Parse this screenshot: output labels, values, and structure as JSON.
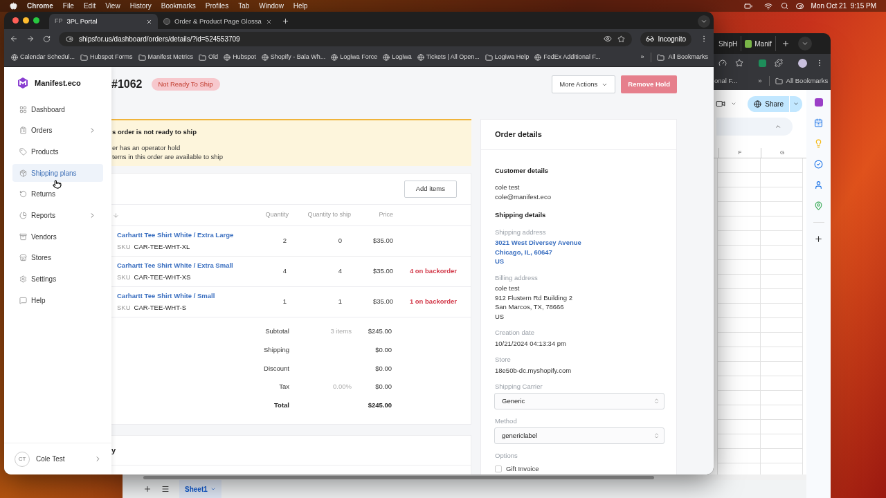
{
  "menu_bar": {
    "app": "Chrome",
    "menus": [
      "File",
      "Edit",
      "View",
      "History",
      "Bookmarks",
      "Profiles",
      "Tab",
      "Window",
      "Help"
    ],
    "clock": "Mon Oct 21  9:15 PM"
  },
  "back_window": {
    "tabs": [
      "ShipH",
      "Manif"
    ],
    "bookmarks": [
      "onal F...",
      "All Bookmarks"
    ],
    "overflow": "»",
    "share": "Share",
    "columns": [
      "F",
      "G"
    ],
    "sheet_tab": "Sheet1"
  },
  "browser": {
    "tabs": [
      {
        "favicon": "FP",
        "label": "3PL Portal",
        "selected": true
      },
      {
        "label": "Order & Product Page Glossa",
        "selected": false
      }
    ],
    "url": "shipsfor.us/dashboard/orders/details/?id=524553709",
    "profile": "Incognito",
    "bookmarks": [
      {
        "kind": "site",
        "label": "Calendar Schedul..."
      },
      {
        "kind": "folder",
        "label": "Hubspot Forms"
      },
      {
        "kind": "folder",
        "label": "Manifest Metrics"
      },
      {
        "kind": "folder",
        "label": "Old"
      },
      {
        "kind": "site",
        "label": "Hubspot"
      },
      {
        "kind": "site",
        "label": "Shopify - Bala Wh..."
      },
      {
        "kind": "site",
        "label": "Logiwa Force"
      },
      {
        "kind": "site",
        "label": "Logiwa"
      },
      {
        "kind": "site",
        "label": "Tickets | All Open..."
      },
      {
        "kind": "folder",
        "label": "Logiwa Help"
      },
      {
        "kind": "site",
        "label": "FedEx Additional F..."
      }
    ],
    "overflow": "»",
    "all_bookmarks": "All Bookmarks"
  },
  "sidebar": {
    "brand": "Manifest.eco",
    "items": [
      {
        "label": "Dashboard",
        "has_submenu": false,
        "selected": false
      },
      {
        "label": "Orders",
        "has_submenu": true,
        "selected": false
      },
      {
        "label": "Products",
        "has_submenu": false,
        "selected": false
      },
      {
        "label": "Shipping plans",
        "has_submenu": false,
        "selected": true
      },
      {
        "label": "Returns",
        "has_submenu": false,
        "selected": false
      },
      {
        "label": "Reports",
        "has_submenu": true,
        "selected": false
      },
      {
        "label": "Vendors",
        "has_submenu": false,
        "selected": false
      },
      {
        "label": "Stores",
        "has_submenu": false,
        "selected": false
      },
      {
        "label": "Settings",
        "has_submenu": false,
        "selected": false
      },
      {
        "label": "Help",
        "has_submenu": false,
        "selected": false
      }
    ],
    "user": {
      "initials": "CT",
      "name": "Cole Test"
    }
  },
  "order": {
    "number": "#1062",
    "status": "Not Ready To Ship",
    "actions": [
      {
        "label": "More Actions",
        "kind": "dropdown",
        "disabled": false
      },
      {
        "label": "Remove Hold",
        "kind": "primary",
        "disabled": true
      }
    ]
  },
  "alert": {
    "title": "s order is not ready to ship",
    "lines": [
      "er has an operator hold",
      "tems in this order are available to ship"
    ]
  },
  "items": {
    "add_button": "Add items",
    "columns": [
      "Quantity",
      "Quantity to ship",
      "Price"
    ],
    "rows": [
      {
        "name": "Carhartt Tee Shirt White / Extra Large",
        "sku_label": "SKU",
        "sku": "CAR-TEE-WHT-XL",
        "quantity": "2",
        "to_ship": "0",
        "price": "$35.00"
      },
      {
        "name": "Carhartt Tee Shirt White / Extra Small",
        "sku_label": "SKU",
        "sku": "CAR-TEE-WHT-XS",
        "quantity": "4",
        "to_ship": "4",
        "price": "$35.00",
        "backorder": "4 on backorder"
      },
      {
        "name": "Carhartt Tee Shirt White / Small",
        "sku_label": "SKU",
        "sku": "CAR-TEE-WHT-S",
        "quantity": "1",
        "to_ship": "1",
        "price": "$35.00",
        "backorder": "1 on backorder"
      }
    ],
    "totals": [
      {
        "kind": "line",
        "label": "Subtotal",
        "note": "3 items",
        "amount": "$245.00"
      },
      {
        "kind": "line",
        "label": "Shipping",
        "amount": "$0.00"
      },
      {
        "kind": "line",
        "label": "Discount",
        "amount": "$0.00"
      },
      {
        "kind": "line",
        "label": "Tax",
        "note": "0.00%",
        "amount": "$0.00"
      },
      {
        "kind": "total",
        "label": "Total",
        "amount": "$245.00"
      }
    ]
  },
  "next_card": {
    "title": "y"
  },
  "order_details": {
    "title": "Order details",
    "blocks": [
      {
        "kind": "heading",
        "text": "Customer details"
      },
      {
        "kind": "lines",
        "lines": [
          "cole test",
          "cole@manifest.eco"
        ]
      },
      {
        "kind": "heading",
        "text": "Shipping details"
      },
      {
        "kind": "field",
        "label": "Shipping address",
        "link": true,
        "lines": [
          "3021 West Diversey Avenue",
          "Chicago, IL, 60647",
          "US"
        ]
      },
      {
        "kind": "field",
        "label": "Billing address",
        "link": false,
        "lines": [
          "cole test",
          "912 Flustern Rd Building 2",
          "San Marcos, TX, 78666",
          "US"
        ]
      },
      {
        "kind": "field",
        "label": "Creation date",
        "link": false,
        "lines": [
          "10/21/2024 04:13:34 pm"
        ]
      },
      {
        "kind": "field",
        "label": "Store",
        "link": false,
        "lines": [
          "18e50b-dc.myshopify.com"
        ]
      },
      {
        "kind": "select",
        "label": "Shipping Carrier",
        "value": "Generic"
      },
      {
        "kind": "select",
        "label": "Method",
        "value": "genericlabel"
      },
      {
        "kind": "options",
        "label": "Options",
        "options": [
          {
            "label": "Gift Invoice",
            "checked": false
          }
        ]
      }
    ]
  }
}
